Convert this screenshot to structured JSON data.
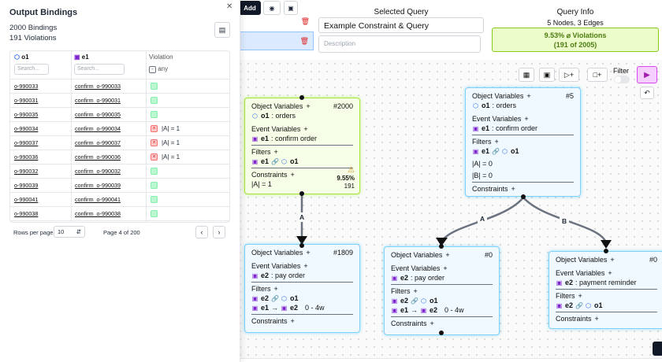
{
  "toolbar": {
    "add_label": "Add",
    "eye_icon": "eye-icon",
    "save_icon": "save-icon"
  },
  "selected_query": {
    "title": "Selected Query",
    "name": "Example Constraint & Query",
    "description_placeholder": "Description"
  },
  "query_info": {
    "title": "Query Info",
    "summary": "5 Nodes, 3 Edges",
    "violation_pct": "9.53% ⌀ Violations",
    "violation_ratio": "(191 of 2005)"
  },
  "canvas": {
    "filter_label": "Filter"
  },
  "nodes": {
    "n1": {
      "obj_label": "Object Variables",
      "count": "#2000",
      "obj_var": "o1",
      "obj_type": ": orders",
      "ev_label": "Event Variables",
      "ev_var": "e1",
      "ev_type": ": confirm order",
      "filters_label": "Filters",
      "f1_a": "e1",
      "f1_b": "o1",
      "constraints_label": "Constraints",
      "constraint": "|A| = 1",
      "warn_pct": "9.55%",
      "warn_count": "191"
    },
    "n2": {
      "obj_label": "Object Variables",
      "count": "#5",
      "obj_var": "o1",
      "obj_type": ": orders",
      "ev_label": "Event Variables",
      "ev_var": "e1",
      "ev_type": ": confirm order",
      "filters_label": "Filters",
      "f1_a": "e1",
      "f1_b": "o1",
      "c1": "|A| = 0",
      "c2": "|B| = 0",
      "constraints_label": "Constraints"
    },
    "n3": {
      "obj_label": "Object Variables",
      "count": "#1809",
      "ev_label": "Event Variables",
      "ev_var": "e2",
      "ev_type": ": pay order",
      "filters_label": "Filters",
      "f1_a": "e2",
      "f1_b": "o1",
      "f2_a": "e1",
      "f2_b": "e2",
      "f2_range": "0 - 4w",
      "constraints_label": "Constraints"
    },
    "n4": {
      "obj_label": "Object Variables",
      "count": "#0",
      "ev_label": "Event Variables",
      "ev_var": "e2",
      "ev_type": ": pay order",
      "filters_label": "Filters",
      "f1_a": "e2",
      "f1_b": "o1",
      "f2_a": "e1",
      "f2_b": "e2",
      "f2_range": "0 - 4w",
      "constraints_label": "Constraints"
    },
    "n5": {
      "obj_label": "Object Variables",
      "count": "#0",
      "ev_label": "Event Variables",
      "ev_var": "e2",
      "ev_type": ": payment reminder",
      "filters_label": "Filters",
      "f1_a": "e2",
      "f1_b": "o1",
      "constraints_label": "Constraints"
    }
  },
  "edges": {
    "e1": "A",
    "e2": "A",
    "e3": "B"
  },
  "panel": {
    "title": "Output Bindings",
    "bindings_count": "2000 Bindings",
    "violations_count": "191 Violations",
    "columns": {
      "o1": "o1",
      "e1": "e1",
      "violation": "Violation",
      "any": "any"
    },
    "search_placeholder": "Search...",
    "rows": [
      {
        "o1": "o-990033",
        "e1": "confirm_o-990033",
        "violated": false,
        "text": ""
      },
      {
        "o1": "o-990031",
        "e1": "confirm_o-990031",
        "violated": false,
        "text": ""
      },
      {
        "o1": "o-990035",
        "e1": "confirm_o-990035",
        "violated": false,
        "text": ""
      },
      {
        "o1": "o-990034",
        "e1": "confirm_o-990034",
        "violated": true,
        "text": "|A| = 1"
      },
      {
        "o1": "o-990037",
        "e1": "confirm_o-990037",
        "violated": true,
        "text": "|A| = 1"
      },
      {
        "o1": "o-990036",
        "e1": "confirm_o-990036",
        "violated": true,
        "text": "|A| = 1"
      },
      {
        "o1": "o-990032",
        "e1": "confirm_o-990032",
        "violated": false,
        "text": ""
      },
      {
        "o1": "o-990039",
        "e1": "confirm_o-990039",
        "violated": false,
        "text": ""
      },
      {
        "o1": "o-990041",
        "e1": "confirm_o-990041",
        "violated": false,
        "text": ""
      },
      {
        "o1": "o-990038",
        "e1": "confirm_o-990038",
        "violated": false,
        "text": ""
      }
    ],
    "rows_per_page_label": "Rows per page",
    "rows_per_page": "10",
    "page_label": "Page 4 of 200"
  }
}
